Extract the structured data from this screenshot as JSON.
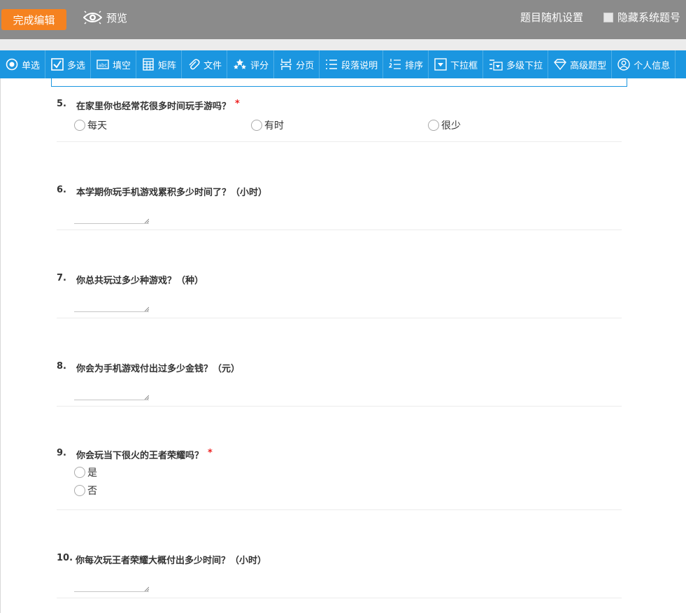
{
  "topbar": {
    "finish_label": "完成编辑",
    "preview_label": "预览",
    "random_label": "题目随机设置",
    "hide_label": "隐藏系统题号"
  },
  "toolbar": {
    "items": [
      {
        "label": "单选",
        "icon": "radio-icon"
      },
      {
        "label": "多选",
        "icon": "checkbox-icon"
      },
      {
        "label": "填空",
        "icon": "fill-blank-icon"
      },
      {
        "label": "矩阵",
        "icon": "matrix-icon"
      },
      {
        "label": "文件",
        "icon": "paperclip-icon"
      },
      {
        "label": "评分",
        "icon": "stars-icon"
      },
      {
        "label": "分页",
        "icon": "page-break-icon"
      },
      {
        "label": "段落说明",
        "icon": "paragraph-icon"
      },
      {
        "label": "排序",
        "icon": "sort-icon"
      },
      {
        "label": "下拉框",
        "icon": "dropdown-icon"
      },
      {
        "label": "多级下拉",
        "icon": "multi-dropdown-icon"
      },
      {
        "label": "高级题型",
        "icon": "diamond-icon"
      },
      {
        "label": "个人信息",
        "icon": "user-icon"
      }
    ]
  },
  "questions": [
    {
      "num": "5.",
      "title": "在家里你也经常花很多时间玩手游吗？",
      "required": "*",
      "options": [
        "每天",
        "有时",
        "很少"
      ]
    },
    {
      "num": "6.",
      "title": "本学期你玩手机游戏累积多少时间了？（小时）"
    },
    {
      "num": "7.",
      "title": "你总共玩过多少种游戏？（种）"
    },
    {
      "num": "8.",
      "title": "你会为手机游戏付出过多少金钱？（元）"
    },
    {
      "num": "9.",
      "title": "你会玩当下很火的王者荣耀吗？",
      "required": "*",
      "options": [
        "是",
        "否"
      ]
    },
    {
      "num": "10.",
      "title": "你每次玩王者荣耀大概付出多少时间？（小时）"
    }
  ]
}
